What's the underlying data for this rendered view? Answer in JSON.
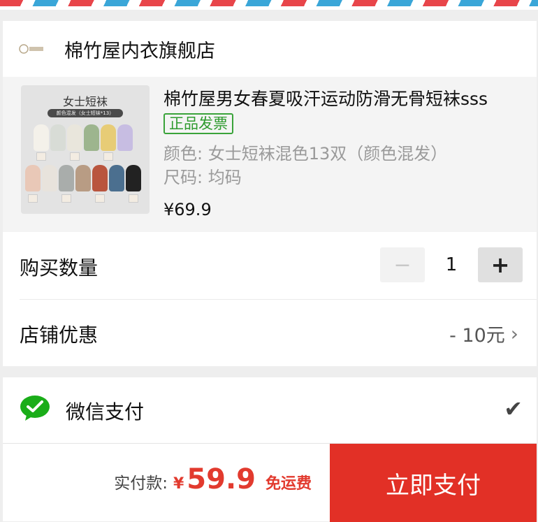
{
  "shop": {
    "name": "棉竹屋内衣旗舰店",
    "logo_icon": "shop-logo-icon"
  },
  "product": {
    "title": "棉竹屋男女春夏吸汗运动防滑无骨短袜sss",
    "badge": "正品发票",
    "color_label": "颜色: 女士短袜混色13双（颜色混发）",
    "size_label": "尺码: 均码",
    "price": "¥69.9",
    "image": {
      "title": "女士短袜",
      "subtitle": "颜色混发（女士短袜*13）"
    }
  },
  "quantity": {
    "label": "购买数量",
    "value": "1",
    "minus": "−",
    "plus": "+"
  },
  "discount": {
    "label": "店铺优惠",
    "value": "- 10元",
    "chevron": "›"
  },
  "payment": {
    "method": "微信支付",
    "icon": "wechat-pay-icon",
    "check": "✔"
  },
  "footer": {
    "total_label": "实付款:",
    "currency": "¥",
    "amount": "59.9",
    "shipping": "免运费",
    "pay_button": "立即支付"
  },
  "colors": {
    "accent_red": "#e23026",
    "badge_green": "#3aa33a",
    "wechat_green": "#1aad19"
  }
}
